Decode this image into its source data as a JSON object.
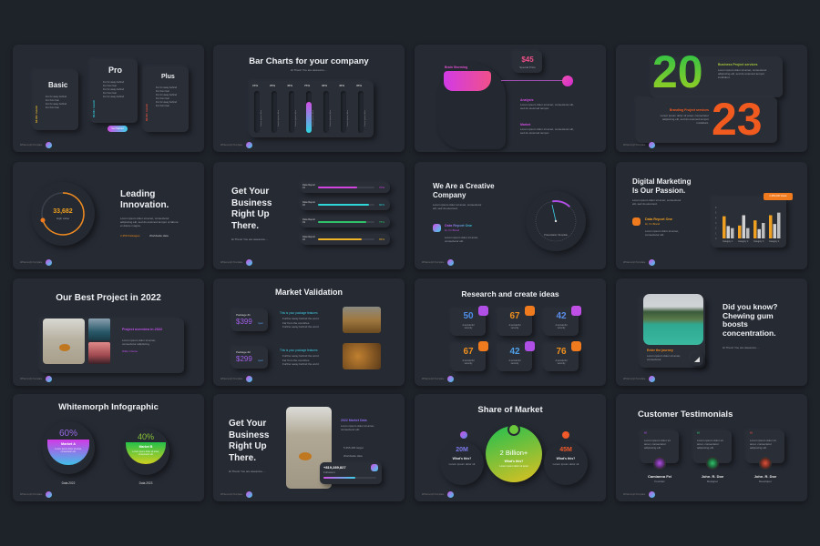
{
  "footer_brand": "Whitemorph Template",
  "colors": {
    "background": "#1e2229",
    "slide": "#262a33",
    "pink": "#e040d8",
    "cyan": "#2fd6e0",
    "green": "#2fc25b",
    "orange": "#f07a1e",
    "yellow": "#f0b429"
  },
  "s1": {
    "plans": [
      {
        "name": "Basic",
        "price": "$3.99 / month",
        "color": "#e6b82a",
        "features": [
          "Fur fur away behind",
          "Fur from fear",
          "Fur fur away behind",
          "Fur from fear"
        ]
      },
      {
        "name": "Pro",
        "price": "$5.99 / month",
        "color": "#2fc9d8",
        "features": [
          "Fur fur away behind",
          "Fur from fear",
          "Fur fur away behind",
          "Fur from fear",
          "Fur fur away behind"
        ],
        "button": "Get Started"
      },
      {
        "name": "Plus",
        "price": "$6.99 / month",
        "color": "#e0503a",
        "features": [
          "Fur fur away behind",
          "Fur from fear",
          "Fur fur away behind",
          "Fur from fear",
          "Fur fur away behind",
          "Fur from fear"
        ]
      }
    ]
  },
  "s2": {
    "title": "Bar Charts for  your company",
    "subtitle": "Hi There! You are awesome....",
    "bars": [
      {
        "label": "15%",
        "value": 15
      },
      {
        "label": "25%",
        "value": 25
      },
      {
        "label": "45%",
        "value": 45
      },
      {
        "label": "75%",
        "value": 75
      },
      {
        "label": "30%",
        "value": 30
      },
      {
        "label": "45%",
        "value": 45
      },
      {
        "label": "35%",
        "value": 35
      }
    ],
    "bar_caption": "Lorem ipsum dolor"
  },
  "s3": {
    "brain_label": "Brain Storming",
    "price": "$45",
    "price_label": "Special Price",
    "items": [
      {
        "title": "Analysis",
        "text": "Lorem ipsum dolor sit amet, consectetur elit, sed do eiusmod tempor."
      },
      {
        "title": "Market",
        "text": "Lorem ipsum dolor sit amet, consectetur elit, sed do eiusmod tempor."
      }
    ]
  },
  "s4": {
    "year_a": "20",
    "year_b": "23",
    "a_title": "Business Project services",
    "a_text": "Lorem ipsum dolor sit amet, consectetur adipiscing elit, sed do eiusmod tempor incididunt.",
    "b_title": "Branding Project services",
    "b_text": "Lorem ipsum dolor sit amet, consectetur adipiscing elit, sed do eiusmod tempor incididunt."
  },
  "s5": {
    "value": "33,682",
    "value_label": "High value",
    "progress": 0.7,
    "title_1": "Leading",
    "title_2": "Innovation.",
    "text": "Lorem ipsum dolor sit amet, consectetur adipiscing elit, sed do eiusmod tempor ut labore et dolore magna.",
    "bullets": [
      "2,356 Packages",
      "Worldwide data"
    ]
  },
  "s6": {
    "title": [
      "Get Your",
      "Business",
      "Right Up",
      "There."
    ],
    "subtitle": "Hi There! You are awesome....",
    "reports": [
      {
        "label": "Data Report 01",
        "value": 70,
        "pct": "70%",
        "color": "#d244e0"
      },
      {
        "label": "Data Report 02",
        "value": 90,
        "pct": "90%",
        "color": "#2fd6d8"
      },
      {
        "label": "Data Report 03",
        "value": 85,
        "pct": "75%",
        "color": "#2fc26a"
      },
      {
        "label": "Data Report 04",
        "value": 78,
        "pct": "65%",
        "color": "#f0b429"
      }
    ]
  },
  "s7": {
    "title": [
      "We Are a Creative",
      "Company"
    ],
    "text": "Lorem ipsum dolor sit amet, consectetur elit, sed do eiusmod.",
    "report_title": "Data Report One",
    "report_sub": "Hi, I'm Brand",
    "report_text": "Lorem ipsum dolor sit amet, consectetur elit.",
    "dial_label": "Presentation Template",
    "gauge": 0.15
  },
  "s8": {
    "title": [
      "Digital Marketing",
      "Is Our Passion."
    ],
    "text": "Lorem ipsum dolor sit amet, consectetur elit, sed do eiusmod.",
    "report_title": "Data Report One",
    "report_sub": "Hi, I'm Brand",
    "report_text": "Lorem ipsum dolor sit amet, consectetur elit.",
    "badge": "2,356,000 Views",
    "chart_data": {
      "type": "bar",
      "categories": [
        "Category 1",
        "Category 2",
        "Category 3",
        "Category 4"
      ],
      "yticks": [
        "0",
        "1",
        "2",
        "3",
        "4",
        "5",
        "6"
      ],
      "ylim": [
        0,
        6
      ],
      "series": [
        {
          "values": [
            4.3,
            2.5,
            3.5,
            4.5
          ],
          "color": "#f0a020"
        },
        {
          "values": [
            2.4,
            4.5,
            1.8,
            2.8
          ],
          "color": "#d0d0d0"
        },
        {
          "values": [
            2.0,
            2.0,
            3.0,
            5.0
          ],
          "color": "#bdbdbd"
        }
      ]
    }
  },
  "s9": {
    "title": "Our Best Project in 2022",
    "card_title": "Project overview in 2022",
    "card_text": "Lorem ipsum dolor sit amet, consectetur adipiscing.",
    "bullet": "Wide Choice"
  },
  "s10": {
    "title": "Market Validation",
    "packages": [
      {
        "label": "Package #1",
        "price": "$399",
        "per": "/year",
        "feature_title": "This is your package features",
        "features": [
          "Further away behind the word",
          "Far from the countries",
          "Further away behind the word"
        ]
      },
      {
        "label": "Package #2",
        "price": "$299",
        "per": "/year",
        "feature_title": "This is your package features",
        "features": [
          "Further away behind the word",
          "Far from the countries",
          "Further away behind the word"
        ]
      }
    ]
  },
  "s11": {
    "title": "Research and create ideas",
    "stats": [
      {
        "value": "50",
        "label": "A wonderful serenity",
        "color": "#4f8de8",
        "icon": "#b04fe6"
      },
      {
        "value": "67",
        "label": "A wonderful serenity",
        "color": "#f0901e",
        "icon": "#f07a1e"
      },
      {
        "value": "42",
        "label": "A wonderful serenity",
        "color": "#5b8de8",
        "icon": "#c04fe6"
      },
      {
        "value": "67",
        "label": "A wonderful serenity",
        "color": "#f0901e",
        "icon": "#f07a1e"
      },
      {
        "value": "42",
        "label": "A wonderful serenity",
        "color": "#4fa0e8",
        "icon": "#b04fe6"
      },
      {
        "value": "76",
        "label": "A wonderful serenity",
        "color": "#f0901e",
        "icon": "#f07a1e"
      }
    ]
  },
  "s12": {
    "card_title": "Enter the journey",
    "card_text": "Lorem ipsum dolor sit amet, consectetur.",
    "title": [
      "Did you know?",
      "Chewing gum",
      "boosts",
      "concentration."
    ],
    "subtitle": "Hi There! You are awesome...."
  },
  "s13": {
    "title": "Whitemorph Infographic",
    "markets": [
      {
        "pct": "60%",
        "name": "Market A",
        "text": "Lorem ipsum dolor sit amet, consectetur elit.",
        "date": "Data 2022"
      },
      {
        "pct": "40%",
        "name": "Market B",
        "text": "Lorem ipsum dolor sit amet, consectetur elit.",
        "date": "Data 2023"
      }
    ]
  },
  "s14": {
    "title": [
      "Get Your",
      "Business",
      "Right Up",
      "There."
    ],
    "subtitle": "Hi There! You are awesome....",
    "data_title": "2022 Market Data",
    "data_text": "Lorem ipsum dolor sit amet, consectetur elit.",
    "bullets": [
      "5,365,400 target",
      "Worldwide data"
    ],
    "number": "+819,289,827",
    "number_label": "Followers",
    "progress": 0.6
  },
  "s15": {
    "title": "Share of Market",
    "left": {
      "value": "20M",
      "label": "What's this?",
      "text": "Lorem ipsum dolor sit"
    },
    "center": {
      "value": "2 Billion+",
      "label": "What's this?",
      "text": "Lorem ipsum dolor sit amet"
    },
    "right": {
      "value": "45M",
      "label": "What's this?",
      "text": "Lorem ipsum dolor sit"
    }
  },
  "s16": {
    "title": "Customer Testimonials",
    "quotes": [
      {
        "text": "Lorem ipsum dolor sit amet, consectetur adipiscing elit.",
        "name": "Camianna Fei",
        "role": "Founder",
        "color": "#b04fe6"
      },
      {
        "text": "Lorem ipsum dolor sit amet, consectetur adipiscing elit.",
        "name": "John. R. Doe",
        "role": "Designer",
        "color": "#2fc26a"
      },
      {
        "text": "Lorem ipsum dolor sit amet, consectetur adipiscing elit.",
        "name": "John. R. Doe",
        "role": "Developer",
        "color": "#e0503a"
      }
    ]
  }
}
